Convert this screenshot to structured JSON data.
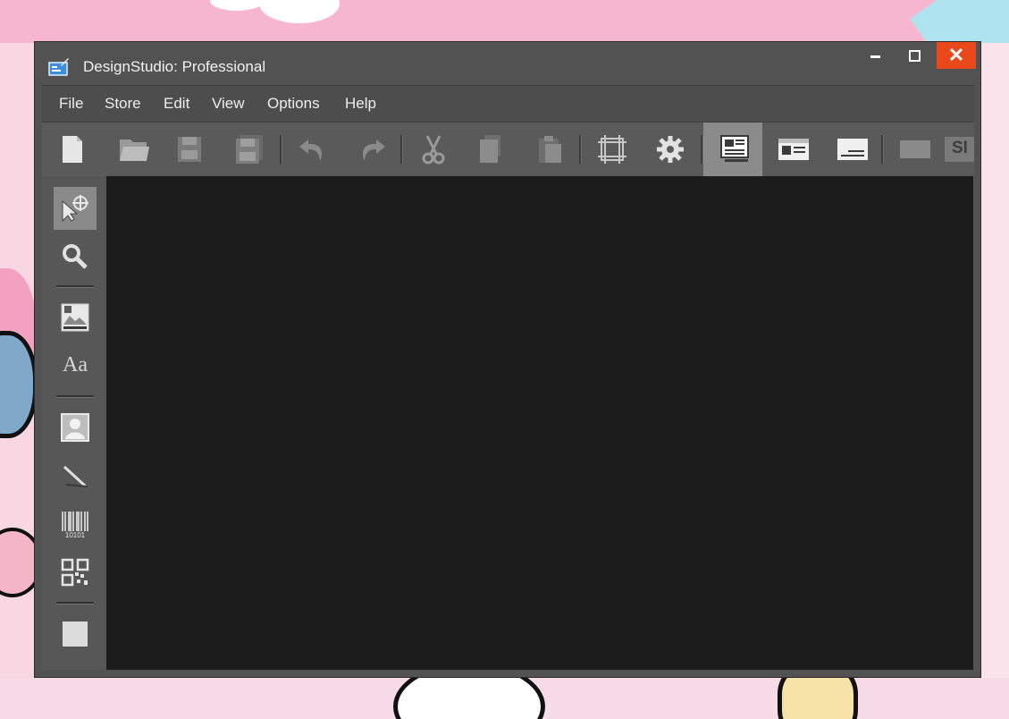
{
  "window": {
    "title": "DesignStudio: Professional",
    "controls": {
      "minimize": "minimize",
      "maximize": "maximize",
      "close": "✕"
    },
    "close_color": "#e8481a"
  },
  "menu": {
    "items": [
      "File",
      "Store",
      "Edit",
      "View",
      "Options",
      "Help"
    ]
  },
  "toolbar": {
    "buttons": [
      {
        "icon": "new-document-icon"
      },
      {
        "icon": "open-folder-icon"
      },
      {
        "icon": "save-icon"
      },
      {
        "icon": "save-as-icon"
      },
      {
        "icon": "undo-icon"
      },
      {
        "icon": "redo-icon"
      },
      {
        "icon": "cut-icon"
      },
      {
        "icon": "copy-icon"
      },
      {
        "icon": "paste-icon"
      },
      {
        "icon": "grid-icon"
      },
      {
        "icon": "settings-gear-icon"
      },
      {
        "icon": "layout-view-1-icon",
        "active": true
      },
      {
        "icon": "layout-view-2-icon"
      },
      {
        "icon": "layout-view-3-icon"
      },
      {
        "icon": "layout-view-4-icon"
      }
    ],
    "clipped_label": "SI"
  },
  "tools": {
    "items": [
      {
        "icon": "select-pointer-icon",
        "active": true
      },
      {
        "icon": "zoom-magnifier-icon"
      },
      {
        "icon": "image-icon"
      },
      {
        "icon": "text-tool-icon",
        "label": "Aa"
      },
      {
        "icon": "photo-portrait-icon"
      },
      {
        "icon": "line-tool-icon"
      },
      {
        "icon": "barcode-icon",
        "label": "10101"
      },
      {
        "icon": "qr-code-icon"
      },
      {
        "icon": "rectangle-shape-icon"
      }
    ]
  },
  "colors": {
    "window_bg": "#525252",
    "canvas_bg": "#1c1c1c",
    "active_tool_bg": "#8a8a8a"
  }
}
